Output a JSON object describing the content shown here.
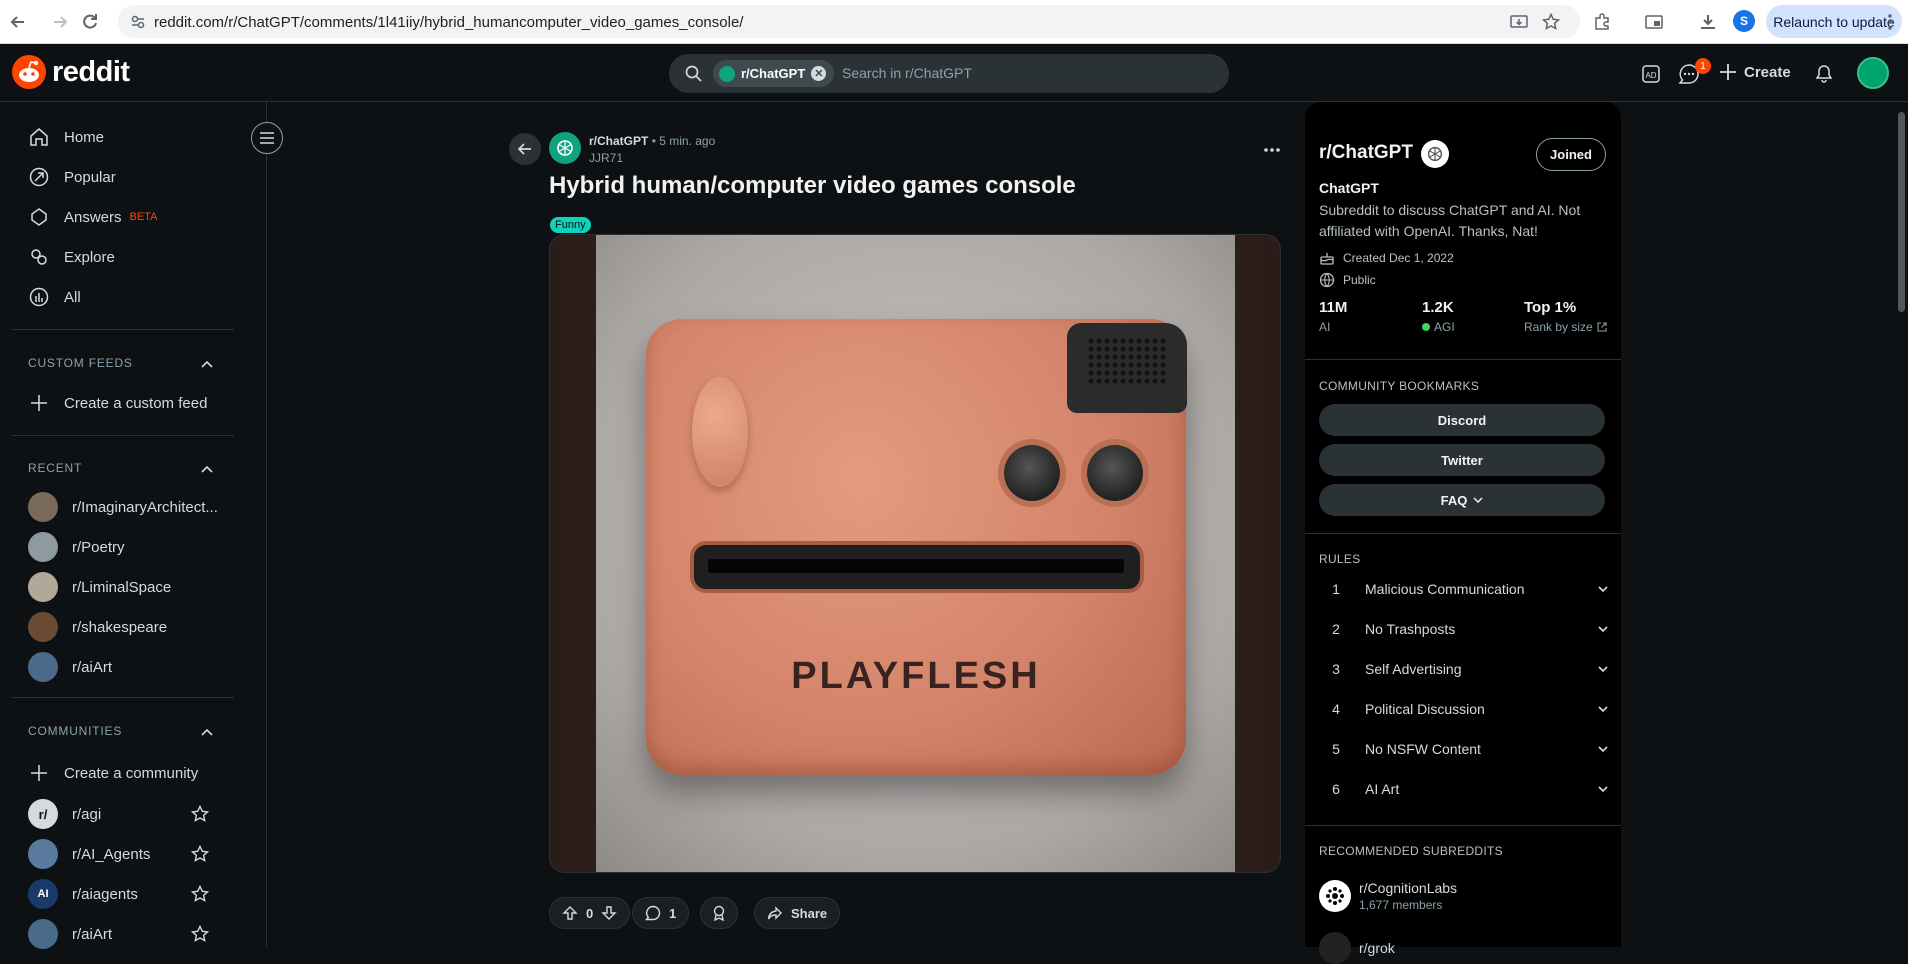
{
  "browser": {
    "url": "reddit.com/r/ChatGPT/comments/1l41iiy/hybrid_humancomputer_video_games_console/",
    "profile_initial": "S",
    "relaunch_label": "Relaunch to update"
  },
  "header": {
    "logo_text": "reddit",
    "search_chip": "r/ChatGPT",
    "search_placeholder": "Search in r/ChatGPT",
    "create_label": "Create",
    "chat_badge": "1"
  },
  "sidebar": {
    "nav": [
      {
        "label": "Home",
        "icon": "home-icon"
      },
      {
        "label": "Popular",
        "icon": "popular-icon"
      },
      {
        "label": "Answers",
        "badge": "BETA",
        "icon": "answers-icon"
      },
      {
        "label": "Explore",
        "icon": "explore-icon"
      },
      {
        "label": "All",
        "icon": "all-icon"
      }
    ],
    "custom_feeds_title": "CUSTOM FEEDS",
    "create_feed_label": "Create a custom feed",
    "recent_title": "RECENT",
    "recent": [
      {
        "name": "r/ImaginaryArchitect...",
        "color": "#7a6a5c"
      },
      {
        "name": "r/Poetry",
        "color": "#8e9aa0"
      },
      {
        "name": "r/LiminalSpace",
        "color": "#b0a898"
      },
      {
        "name": "r/shakespeare",
        "color": "#6a4a32"
      },
      {
        "name": "r/aiArt",
        "color": "#4a6a8a"
      }
    ],
    "communities_title": "COMMUNITIES",
    "create_community_label": "Create a community",
    "communities": [
      {
        "name": "r/agi",
        "avatar_text": "r/",
        "color": "#d7dadc"
      },
      {
        "name": "r/AI_Agents",
        "avatar_text": "",
        "color": "#5a7aa0"
      },
      {
        "name": "r/aiagents",
        "avatar_text": "AI",
        "color": "#1a3a6a"
      },
      {
        "name": "r/aiArt",
        "avatar_text": "",
        "color": "#4a6a8a"
      }
    ]
  },
  "post": {
    "subreddit": "r/ChatGPT",
    "time": "• 5 min. ago",
    "author": "JJR71",
    "title": "Hybrid human/computer video games console",
    "flair": "Funny",
    "image_text": "PLAYFLESH",
    "votes": "0",
    "comments": "1",
    "share_label": "Share"
  },
  "community": {
    "name": "r/ChatGPT",
    "joined_label": "Joined",
    "title": "ChatGPT",
    "description": "Subreddit to discuss ChatGPT and AI. Not affiliated with OpenAI. Thanks, Nat!",
    "created": "Created Dec 1, 2022",
    "visibility": "Public",
    "stats": [
      {
        "value": "11M",
        "label": "AI"
      },
      {
        "value": "1.2K",
        "label": "AGI"
      },
      {
        "value": "Top 1%",
        "label": "Rank by size"
      }
    ],
    "bookmarks_title": "COMMUNITY BOOKMARKS",
    "bookmarks": [
      "Discord",
      "Twitter",
      "FAQ"
    ],
    "rules_title": "RULES",
    "rules": [
      {
        "num": "1",
        "text": "Malicious Communication"
      },
      {
        "num": "2",
        "text": "No Trashposts"
      },
      {
        "num": "3",
        "text": "Self Advertising"
      },
      {
        "num": "4",
        "text": "Political Discussion"
      },
      {
        "num": "5",
        "text": "No NSFW Content"
      },
      {
        "num": "6",
        "text": "AI Art"
      }
    ],
    "recommended_title": "RECOMMENDED SUBREDDITS",
    "recommended": [
      {
        "name": "r/CognitionLabs",
        "members": "1,677 members"
      },
      {
        "name": "r/grok",
        "members": ""
      }
    ]
  },
  "colors": {
    "accent": "#ff4500",
    "flair": "#0dd3bb",
    "online": "#46d160"
  }
}
